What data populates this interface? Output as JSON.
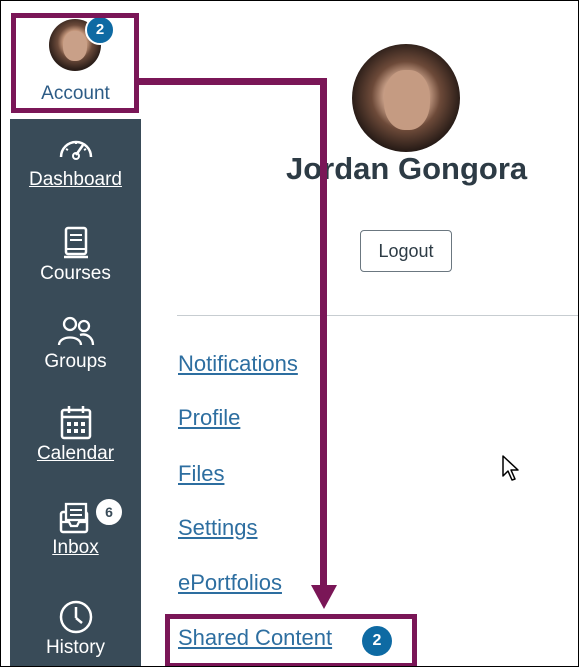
{
  "account": {
    "label": "Account",
    "badge": "2"
  },
  "nav": [
    {
      "label": "Dashboard",
      "icon": "dashboard-icon"
    },
    {
      "label": "Courses",
      "icon": "courses-icon"
    },
    {
      "label": "Groups",
      "icon": "groups-icon"
    },
    {
      "label": "Calendar",
      "icon": "calendar-icon"
    },
    {
      "label": "Inbox",
      "icon": "inbox-icon",
      "badge": "6"
    },
    {
      "label": "History",
      "icon": "history-icon"
    }
  ],
  "profile": {
    "name": "Jordan Gongora",
    "logout_label": "Logout"
  },
  "menu": [
    {
      "label": "Notifications"
    },
    {
      "label": "Profile"
    },
    {
      "label": "Files"
    },
    {
      "label": "Settings"
    },
    {
      "label": "ePortfolios"
    },
    {
      "label": "Shared Content",
      "badge": "2"
    }
  ],
  "colors": {
    "sidebar": "#394b58",
    "highlight": "#7a1657",
    "badge": "#0e6aa3",
    "link": "#2d6ea0"
  }
}
